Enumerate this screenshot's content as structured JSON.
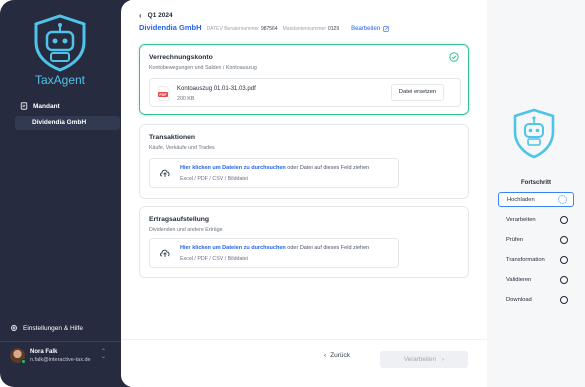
{
  "sidebar": {
    "brand": "TaxAgent",
    "nav_label": "Mandant",
    "selected_client": "Dividendia GmbH",
    "settings_label": "Einstellungen & Hilfe",
    "user": {
      "name": "Nora Falk",
      "email": "n.falk@interactive-tax.de"
    }
  },
  "header": {
    "period": "Q1 2024",
    "company": "Dividendia GmbH",
    "datev_label": "DATEV Beraternummer",
    "datev_value": "987564",
    "mandant_label": "Mandantennummer",
    "mandant_value": "0129",
    "edit_label": "Bearbeiten"
  },
  "cards": [
    {
      "title": "Verrechnungskonto",
      "subtitle": "Kontobewegungen und Salden / Kontoauszug",
      "status": "complete",
      "file": {
        "icon_label": "PDF",
        "name": "Kontoauszug 01.01-31.03.pdf",
        "size": "200 KB",
        "replace_label": "Datei ersetzen"
      }
    },
    {
      "title": "Transaktionen",
      "subtitle": "Käufe, Verkäufe und Trades",
      "status": "empty",
      "drop": {
        "link": "Hier klicken um Dateien zu durchsuchen",
        "text": "oder Datei auf dieses Feld ziehen",
        "formats": "Excel / PDF / CSV / Bilddatei"
      }
    },
    {
      "title": "Ertragsaufstellung",
      "subtitle": "Dividenden und andere Erträge",
      "status": "empty",
      "drop": {
        "link": "Hier klicken um Dateien zu durchsuchen",
        "text": "oder Datei auf dieses Feld ziehen",
        "formats": "Excel / PDF / CSV / Bilddatei"
      }
    }
  ],
  "footer": {
    "back_label": "Zurück",
    "next_label": "Verarbeiten"
  },
  "progress": {
    "title": "Fortschritt",
    "steps": [
      {
        "label": "Hochladen",
        "state": "current"
      },
      {
        "label": "Verarbeiten",
        "state": "pending"
      },
      {
        "label": "Prüfen",
        "state": "pending"
      },
      {
        "label": "Transformation",
        "state": "pending"
      },
      {
        "label": "Validieren",
        "state": "pending"
      },
      {
        "label": "Download",
        "state": "pending"
      }
    ]
  },
  "colors": {
    "sidebar_bg": "#262b3f",
    "brand_cyan": "#4fc3e8",
    "accent_blue": "#2563eb",
    "success_green": "#34c38f",
    "pdf_red": "#e5484d"
  },
  "icons": [
    "robot-shield-logo",
    "document-icon",
    "gear-icon",
    "check-circle-icon",
    "pdf-file-icon",
    "upload-cloud-icon",
    "edit-icon",
    "chevron-left-icon",
    "chevron-right-icon",
    "spinner-icon"
  ]
}
